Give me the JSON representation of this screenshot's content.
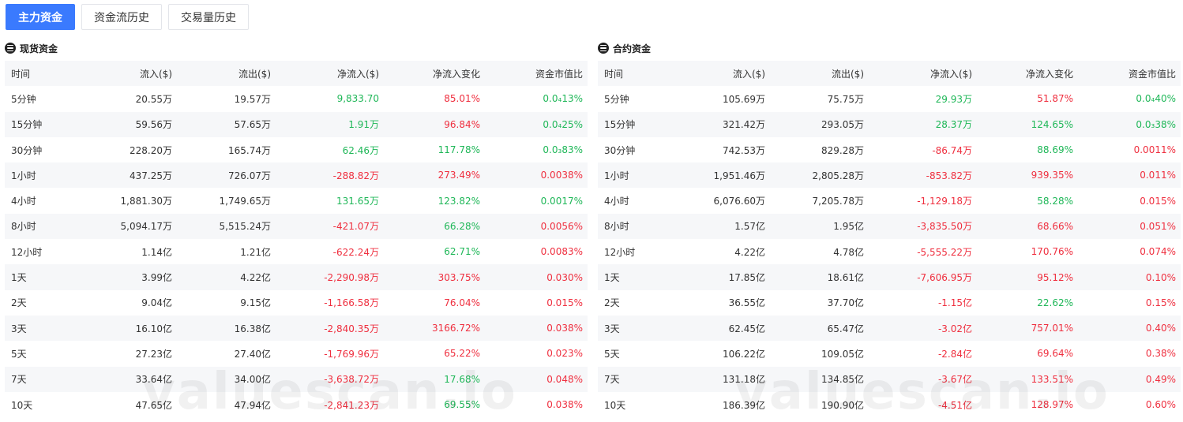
{
  "tabs": [
    "主力资金",
    "资金流历史",
    "交易量历史"
  ],
  "active_tab": 0,
  "watermark": "valuescan.io",
  "colors": {
    "accent": "#3a7afe",
    "up": "#1fb758",
    "down": "#ef2f3f"
  },
  "headers": [
    "时间",
    "流入($)",
    "流出($)",
    "净流入($)",
    "净流入变化",
    "资金市值比"
  ],
  "panels": [
    {
      "title": "现货资金",
      "rows": [
        [
          "5分钟",
          "20.55万",
          "19.57万",
          "9,833.70",
          "85.01%",
          "0.0₄13%"
        ],
        [
          "15分钟",
          "59.56万",
          "57.65万",
          "1.91万",
          "96.84%",
          "0.0₄25%"
        ],
        [
          "30分钟",
          "228.20万",
          "165.74万",
          "62.46万",
          "117.78%",
          "0.0₃83%"
        ],
        [
          "1小时",
          "437.25万",
          "726.07万",
          "-288.82万",
          "273.49%",
          "0.0038%"
        ],
        [
          "4小时",
          "1,881.30万",
          "1,749.65万",
          "131.65万",
          "123.82%",
          "0.0017%"
        ],
        [
          "8小时",
          "5,094.17万",
          "5,515.24万",
          "-421.07万",
          "66.28%",
          "0.0056%"
        ],
        [
          "12小时",
          "1.14亿",
          "1.21亿",
          "-622.24万",
          "62.71%",
          "0.0083%"
        ],
        [
          "1天",
          "3.99亿",
          "4.22亿",
          "-2,290.98万",
          "303.75%",
          "0.030%"
        ],
        [
          "2天",
          "9.04亿",
          "9.15亿",
          "-1,166.58万",
          "76.04%",
          "0.015%"
        ],
        [
          "3天",
          "16.10亿",
          "16.38亿",
          "-2,840.35万",
          "3166.72%",
          "0.038%"
        ],
        [
          "5天",
          "27.23亿",
          "27.40亿",
          "-1,769.96万",
          "65.22%",
          "0.023%"
        ],
        [
          "7天",
          "33.64亿",
          "34.00亿",
          "-3,638.72万",
          "17.68%",
          "0.048%"
        ],
        [
          "10天",
          "47.65亿",
          "47.94亿",
          "-2,841.23万",
          "69.55%",
          "0.038%"
        ]
      ],
      "colors": [
        [
          "up",
          "down",
          "up"
        ],
        [
          "up",
          "down",
          "up"
        ],
        [
          "up",
          "up",
          "up"
        ],
        [
          "down",
          "down",
          "down"
        ],
        [
          "up",
          "up",
          "up"
        ],
        [
          "down",
          "up",
          "down"
        ],
        [
          "down",
          "up",
          "down"
        ],
        [
          "down",
          "down",
          "down"
        ],
        [
          "down",
          "down",
          "down"
        ],
        [
          "down",
          "down",
          "down"
        ],
        [
          "down",
          "down",
          "down"
        ],
        [
          "down",
          "up",
          "down"
        ],
        [
          "down",
          "up",
          "down"
        ]
      ]
    },
    {
      "title": "合约资金",
      "rows": [
        [
          "5分钟",
          "105.69万",
          "75.75万",
          "29.93万",
          "51.87%",
          "0.0₄40%"
        ],
        [
          "15分钟",
          "321.42万",
          "293.05万",
          "28.37万",
          "124.65%",
          "0.0₃38%"
        ],
        [
          "30分钟",
          "742.53万",
          "829.28万",
          "-86.74万",
          "88.69%",
          "0.0011%"
        ],
        [
          "1小时",
          "1,951.46万",
          "2,805.28万",
          "-853.82万",
          "939.35%",
          "0.011%"
        ],
        [
          "4小时",
          "6,076.60万",
          "7,205.78万",
          "-1,129.18万",
          "58.28%",
          "0.015%"
        ],
        [
          "8小时",
          "1.57亿",
          "1.95亿",
          "-3,835.50万",
          "68.66%",
          "0.051%"
        ],
        [
          "12小时",
          "4.22亿",
          "4.78亿",
          "-5,555.22万",
          "170.76%",
          "0.074%"
        ],
        [
          "1天",
          "17.85亿",
          "18.61亿",
          "-7,606.95万",
          "95.12%",
          "0.10%"
        ],
        [
          "2天",
          "36.55亿",
          "37.70亿",
          "-1.15亿",
          "22.62%",
          "0.15%"
        ],
        [
          "3天",
          "62.45亿",
          "65.47亿",
          "-3.02亿",
          "757.01%",
          "0.40%"
        ],
        [
          "5天",
          "106.22亿",
          "109.05亿",
          "-2.84亿",
          "69.64%",
          "0.38%"
        ],
        [
          "7天",
          "131.18亿",
          "134.85亿",
          "-3.67亿",
          "133.51%",
          "0.49%"
        ],
        [
          "10天",
          "186.39亿",
          "190.90亿",
          "-4.51亿",
          "128.97%",
          "0.60%"
        ]
      ],
      "colors": [
        [
          "up",
          "down",
          "up"
        ],
        [
          "up",
          "up",
          "up"
        ],
        [
          "down",
          "up",
          "down"
        ],
        [
          "down",
          "down",
          "down"
        ],
        [
          "down",
          "up",
          "down"
        ],
        [
          "down",
          "down",
          "down"
        ],
        [
          "down",
          "down",
          "down"
        ],
        [
          "down",
          "down",
          "down"
        ],
        [
          "down",
          "up",
          "down"
        ],
        [
          "down",
          "down",
          "down"
        ],
        [
          "down",
          "down",
          "down"
        ],
        [
          "down",
          "down",
          "down"
        ],
        [
          "down",
          "down",
          "down"
        ]
      ]
    }
  ]
}
